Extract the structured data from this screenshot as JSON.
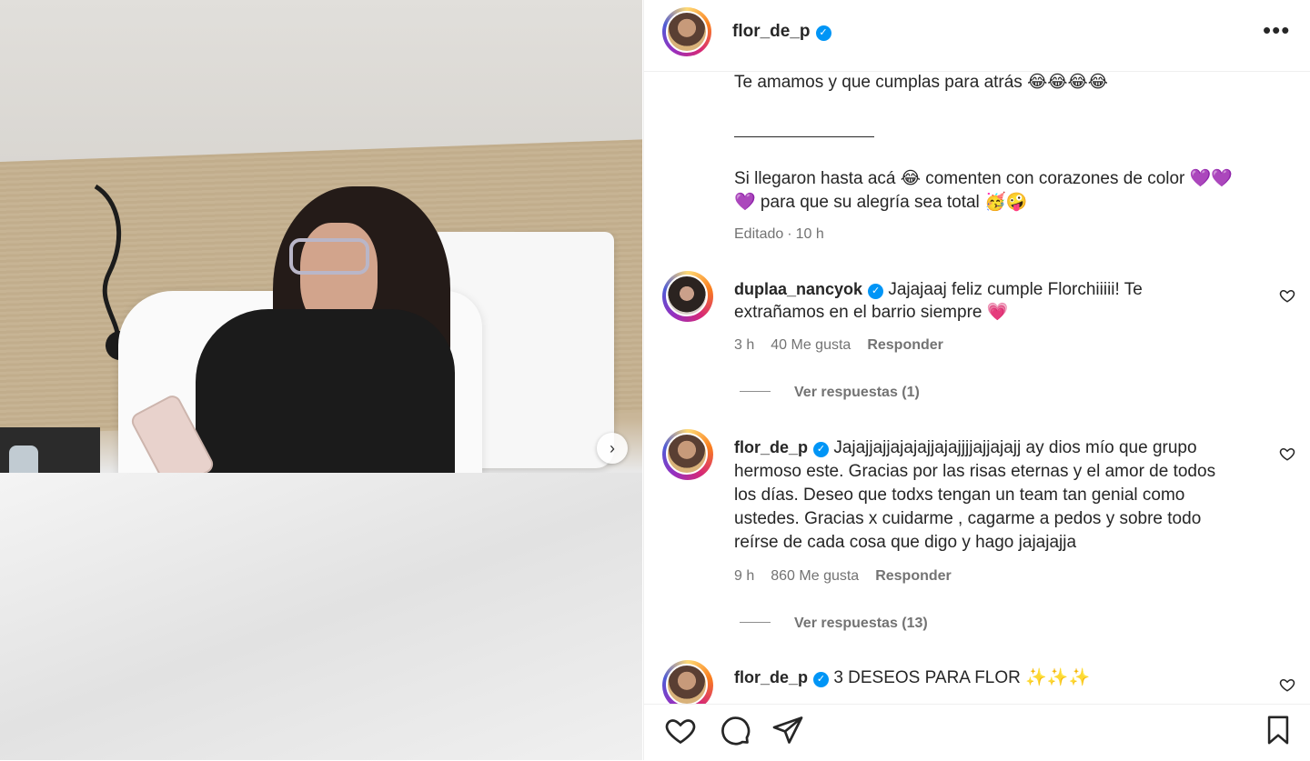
{
  "post": {
    "username": "flor_de_p",
    "verified_label": "✓",
    "more_label": "•••",
    "caption_line1": "Te amamos y que cumplas para atrás 😂😂😂😂",
    "caption_line2": "Si llegaron hasta acá 😂 comenten con corazones de color 💜💜",
    "caption_line3": "💜 para que su alegría sea total 🥳🤪",
    "edited": "Editado",
    "sep": "·",
    "time": "10 h"
  },
  "comments": [
    {
      "username": "duplaa_nancyok",
      "lines": [
        "Jajajaaj feliz cumple Florchiiiii! Te",
        "extrañamos en el barrio siempre 💗"
      ],
      "time": "3 h",
      "likes": "40 Me gusta",
      "reply": "Responder",
      "view_replies": "Ver respuestas (1)"
    },
    {
      "username": "flor_de_p",
      "lines": [
        "Jajajjajjajajajjajajjjjajjajajj ay dios mío que grupo",
        "hermoso este. Gracias por las risas eternas y el amor de todos",
        "los días. Deseo que todxs tengan un team tan genial como",
        "ustedes. Gracias x cuidarme , cagarme a pedos y sobre todo",
        "reírse de cada cosa que digo y hago jajajajja"
      ],
      "time": "9 h",
      "likes": "860 Me gusta",
      "reply": "Responder",
      "view_replies": "Ver respuestas (13)"
    },
    {
      "username": "flor_de_p",
      "lines": [
        "3 DESEOS PARA FLOR ✨✨✨"
      ]
    }
  ],
  "icons": {
    "like": "heart-icon",
    "comment": "comment-icon",
    "share": "send-icon",
    "save": "bookmark-icon",
    "next": "chevron-right-icon"
  }
}
